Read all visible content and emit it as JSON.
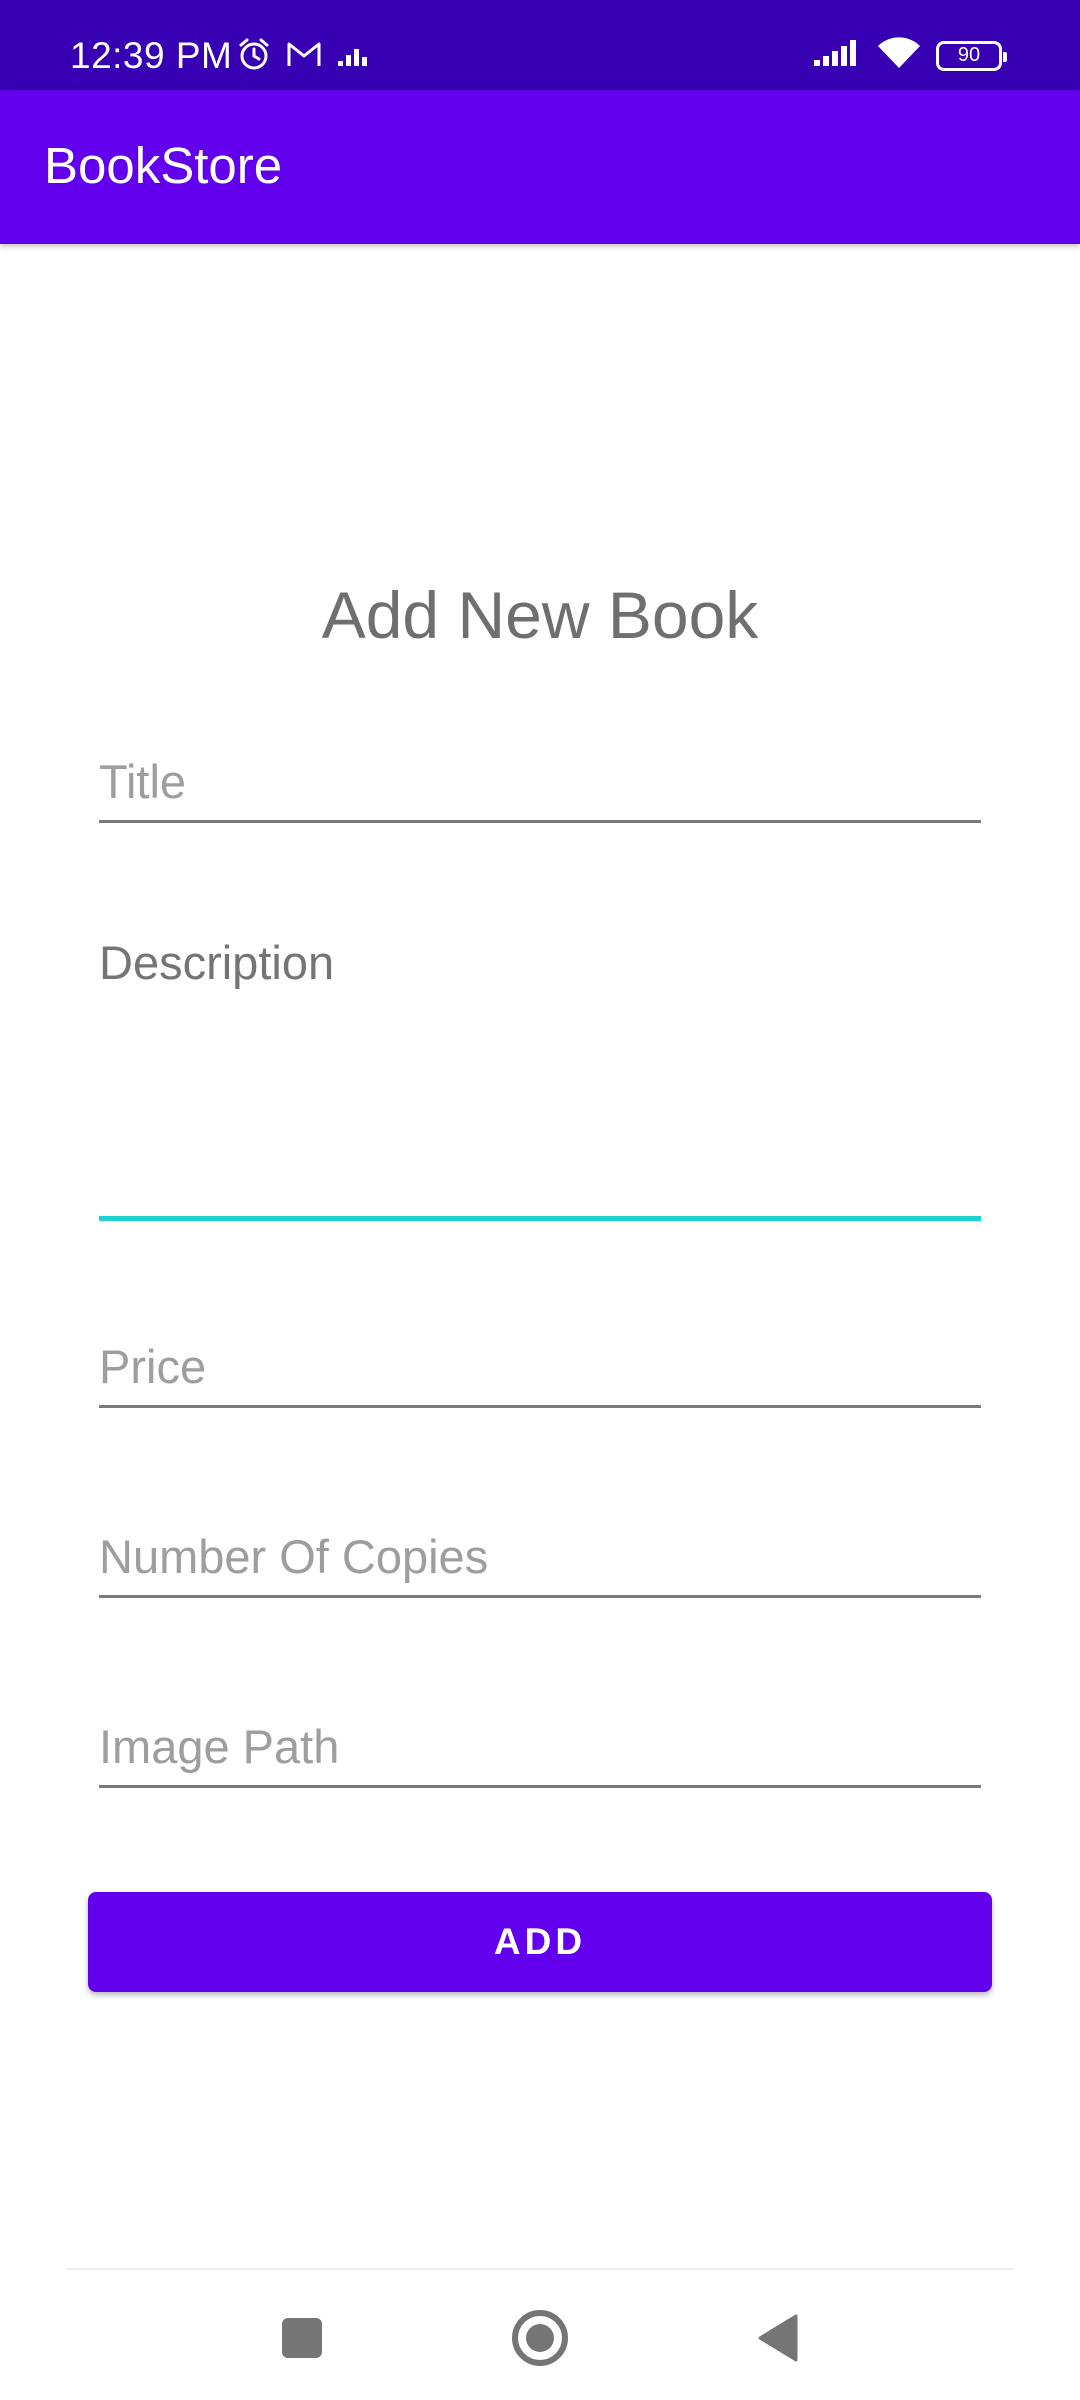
{
  "status_bar": {
    "time": "12:39 PM",
    "battery": "90",
    "left_icons": [
      "alarm-icon",
      "gmail-icon",
      "equalizer-icon"
    ],
    "right_icons": [
      "signal-icon",
      "wifi-icon",
      "battery-icon"
    ]
  },
  "app_bar": {
    "title": "BookStore"
  },
  "form": {
    "heading": "Add New Book",
    "title_placeholder": "Title",
    "description_placeholder": "Description",
    "price_placeholder": "Price",
    "copies_placeholder": "Number Of Copies",
    "image_path_placeholder": "Image Path",
    "add_label": "ADD"
  },
  "nav_bar": {
    "icons": [
      "recents-icon",
      "home-icon",
      "back-icon"
    ]
  },
  "colors": {
    "status_bar": "#3700B3",
    "app_bar": "#6200EE",
    "button": "#6200EE",
    "focused_underline": "#1ED2D2"
  }
}
